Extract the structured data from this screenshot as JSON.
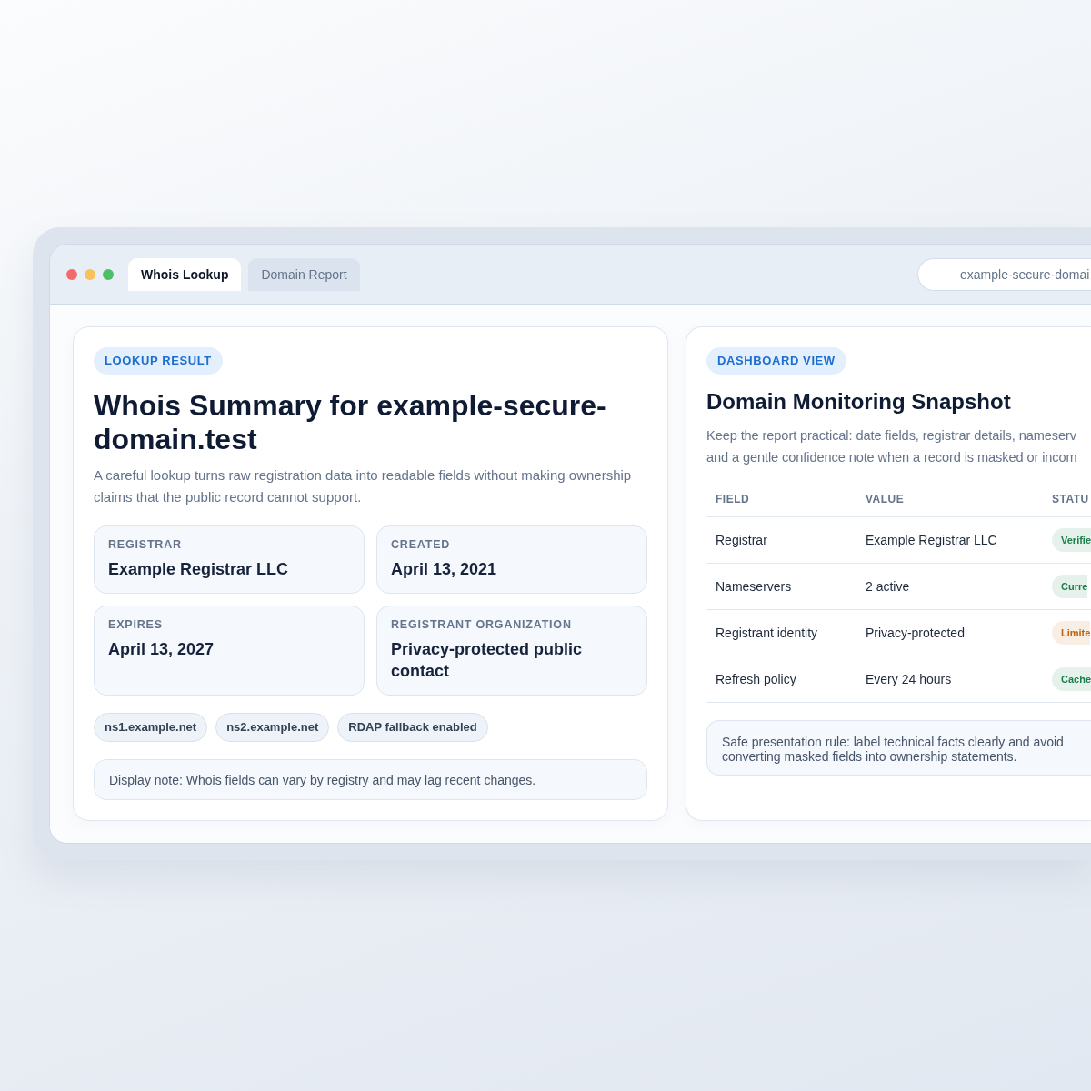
{
  "tabs": [
    {
      "label": "Whois Lookup",
      "selected": true
    },
    {
      "label": "Domain Report",
      "selected": false
    }
  ],
  "address_bar": {
    "value": "example-secure-domai"
  },
  "lookup_card": {
    "tag": "LOOKUP RESULT",
    "title": "Whois Summary for example-secure-domain.test",
    "description": "A careful lookup turns raw registration data into readable fields without making ownership claims that the public record cannot support.",
    "fields": [
      {
        "label": "REGISTRAR",
        "value": "Example Registrar LLC"
      },
      {
        "label": "CREATED",
        "value": "April 13, 2021"
      },
      {
        "label": "EXPIRES",
        "value": "April 13, 2027"
      },
      {
        "label": "REGISTRANT ORGANIZATION",
        "value": "Privacy-protected public contact"
      }
    ],
    "chips": [
      "ns1.example.net",
      "ns2.example.net",
      "RDAP fallback enabled"
    ],
    "note": "Display note: Whois fields can vary by registry and may lag recent changes."
  },
  "dashboard_card": {
    "tag": "DASHBOARD VIEW",
    "title": "Domain Monitoring Snapshot",
    "description_lines": [
      "Keep the report practical: date fields, registrar details, nameserv",
      "and a gentle confidence note when a record is masked or incom"
    ],
    "table": {
      "columns": [
        "FIELD",
        "VALUE",
        "STATU"
      ],
      "rows": [
        {
          "field": "Registrar",
          "value": "Example Registrar LLC",
          "status": "Verifie",
          "color": "#1a7f4b"
        },
        {
          "field": "Nameservers",
          "value": "2 active",
          "status": "Curre",
          "color": "#1a7f4b"
        },
        {
          "field": "Registrant identity",
          "value": "Privacy-protected",
          "status": "Limite",
          "color": "#c2620c"
        },
        {
          "field": "Refresh policy",
          "value": "Every 24 hours",
          "status": "Cache",
          "color": "#1a7f4b"
        }
      ]
    },
    "note": "Safe presentation rule: label technical facts clearly and avoid converting masked fields into ownership statements."
  }
}
